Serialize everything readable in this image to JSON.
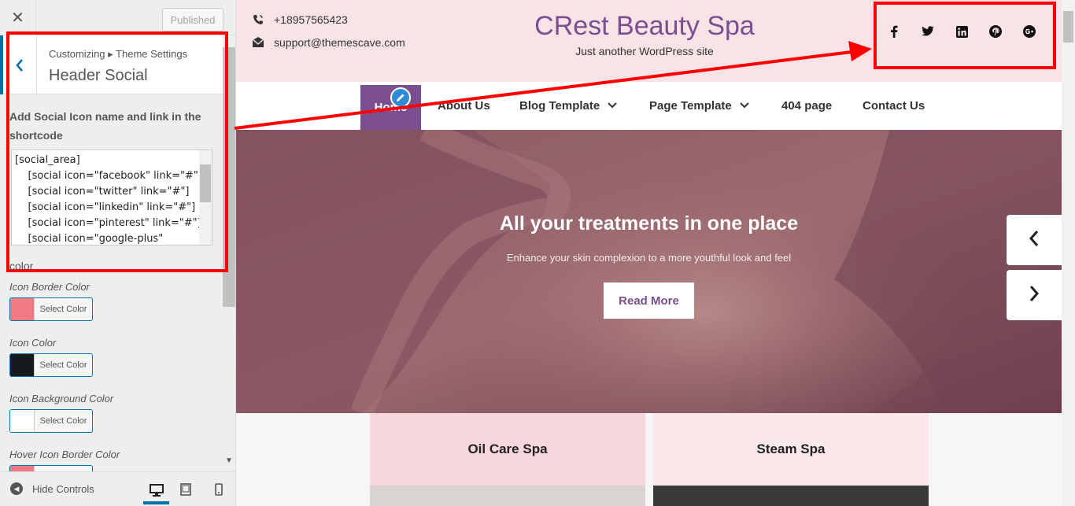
{
  "customizer": {
    "close_glyph": "✕",
    "publish_label": "Published",
    "back_glyph": "‹",
    "breadcrumb": "Customizing ▸ Theme Settings",
    "section_title": "Header Social",
    "field_description": "Add Social Icon name and link in the shortcode",
    "shortcode_lines": [
      "[social_area]",
      "    [social icon=\"facebook\" link=\"#\"]",
      "    [social icon=\"twitter\" link=\"#\"]",
      "    [social icon=\"linkedin\" link=\"#\"]",
      "    [social icon=\"pinterest\" link=\"#\"]",
      "    [social icon=\"google-plus\""
    ],
    "color_heading": "color",
    "color_fields": [
      {
        "label": "Icon Border Color",
        "button": "Select Color",
        "swatch": "#f07b87"
      },
      {
        "label": "Icon Color",
        "button": "Select Color",
        "swatch": "#16191c"
      },
      {
        "label": "Icon Background Color",
        "button": "Select Color",
        "swatch": "#ffffff"
      },
      {
        "label": "Hover Icon Border Color",
        "button": "Select Color",
        "swatch": "#f07b87"
      }
    ],
    "hide_controls": "Hide Controls",
    "devices": [
      "desktop-icon",
      "tablet-icon",
      "mobile-icon"
    ]
  },
  "site": {
    "phone": "+18957565423",
    "email": "support@themescave.com",
    "title": "CRest Beauty Spa",
    "tagline": "Just another WordPress site",
    "social_icons": [
      "facebook-icon",
      "twitter-icon",
      "linkedin-icon",
      "pinterest-icon",
      "google-plus-icon"
    ],
    "nav": {
      "home": "Home",
      "about": "About Us",
      "blog": "Blog Template",
      "page": "Page Template",
      "404": "404 page",
      "contact": "Contact Us"
    },
    "hero": {
      "heading": "All your treatments in one place",
      "subheading": "Enhance your skin complexion to a more youthful look and feel",
      "button": "Read More"
    },
    "services": [
      "Oil Care Spa",
      "Steam Spa"
    ]
  },
  "colors": {
    "accent": "#7b4e8f",
    "wp_blue": "#0073aa",
    "annotation_red": "#ff0000",
    "topbar_pink": "#fae3e6"
  }
}
